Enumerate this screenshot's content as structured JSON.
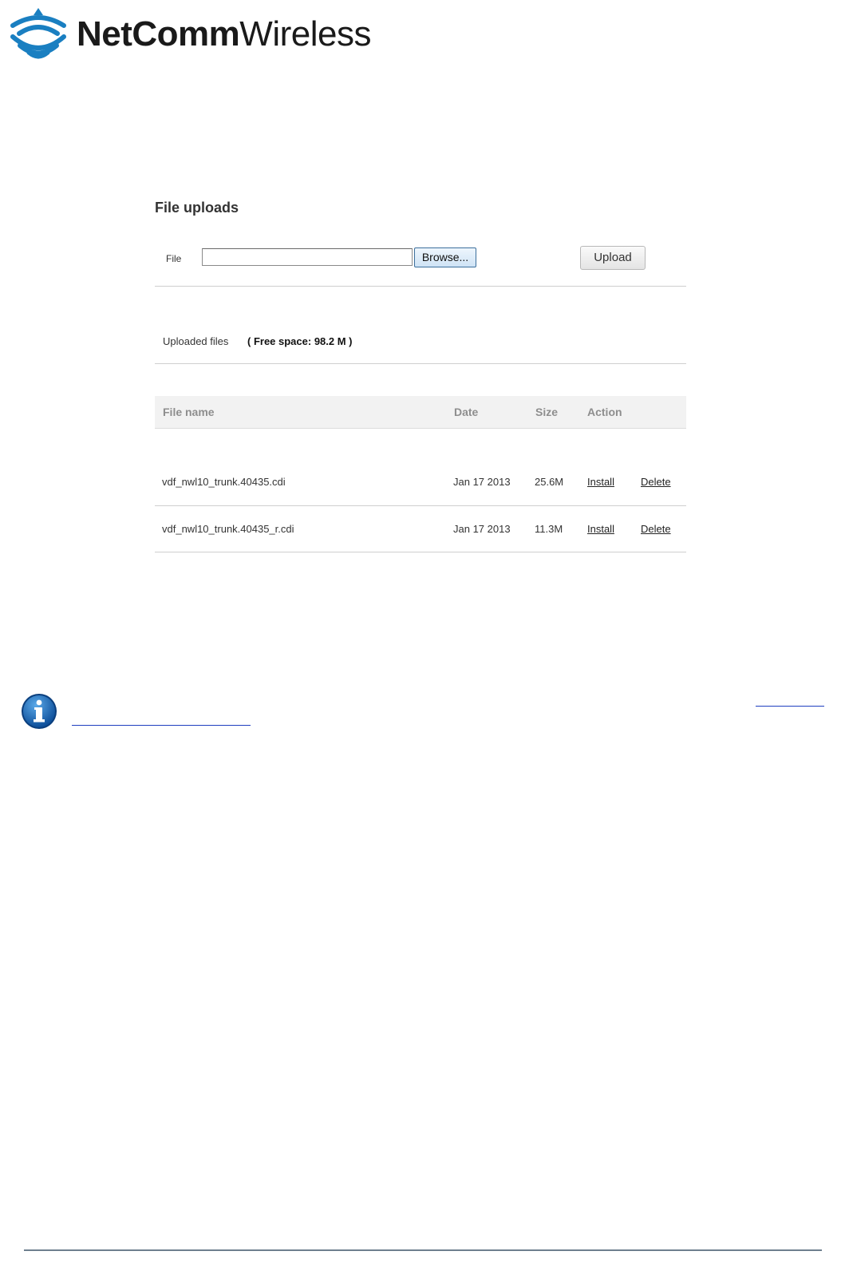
{
  "brand": {
    "name_bold": "NetComm",
    "name_regular": "Wireless",
    "color": "#1a7fc1"
  },
  "file_uploads": {
    "title": "File uploads",
    "file_label": "File",
    "file_value": "",
    "browse_label": "Browse...",
    "upload_label": "Upload"
  },
  "uploaded": {
    "label": "Uploaded files",
    "free_space": "( Free space: 98.2 M )"
  },
  "table": {
    "headers": {
      "name": "File name",
      "date": "Date",
      "size": "Size",
      "action": "Action"
    },
    "rows": [
      {
        "name": "vdf_nwl10_trunk.40435.cdi",
        "date": "Jan 17 2013",
        "size": "25.6M",
        "install": "Install",
        "delete": "Delete"
      },
      {
        "name": "vdf_nwl10_trunk.40435_r.cdi",
        "date": "Jan 17 2013",
        "size": "11.3M",
        "install": "Install",
        "delete": "Delete"
      }
    ]
  },
  "icons": {
    "info": "info-icon"
  }
}
